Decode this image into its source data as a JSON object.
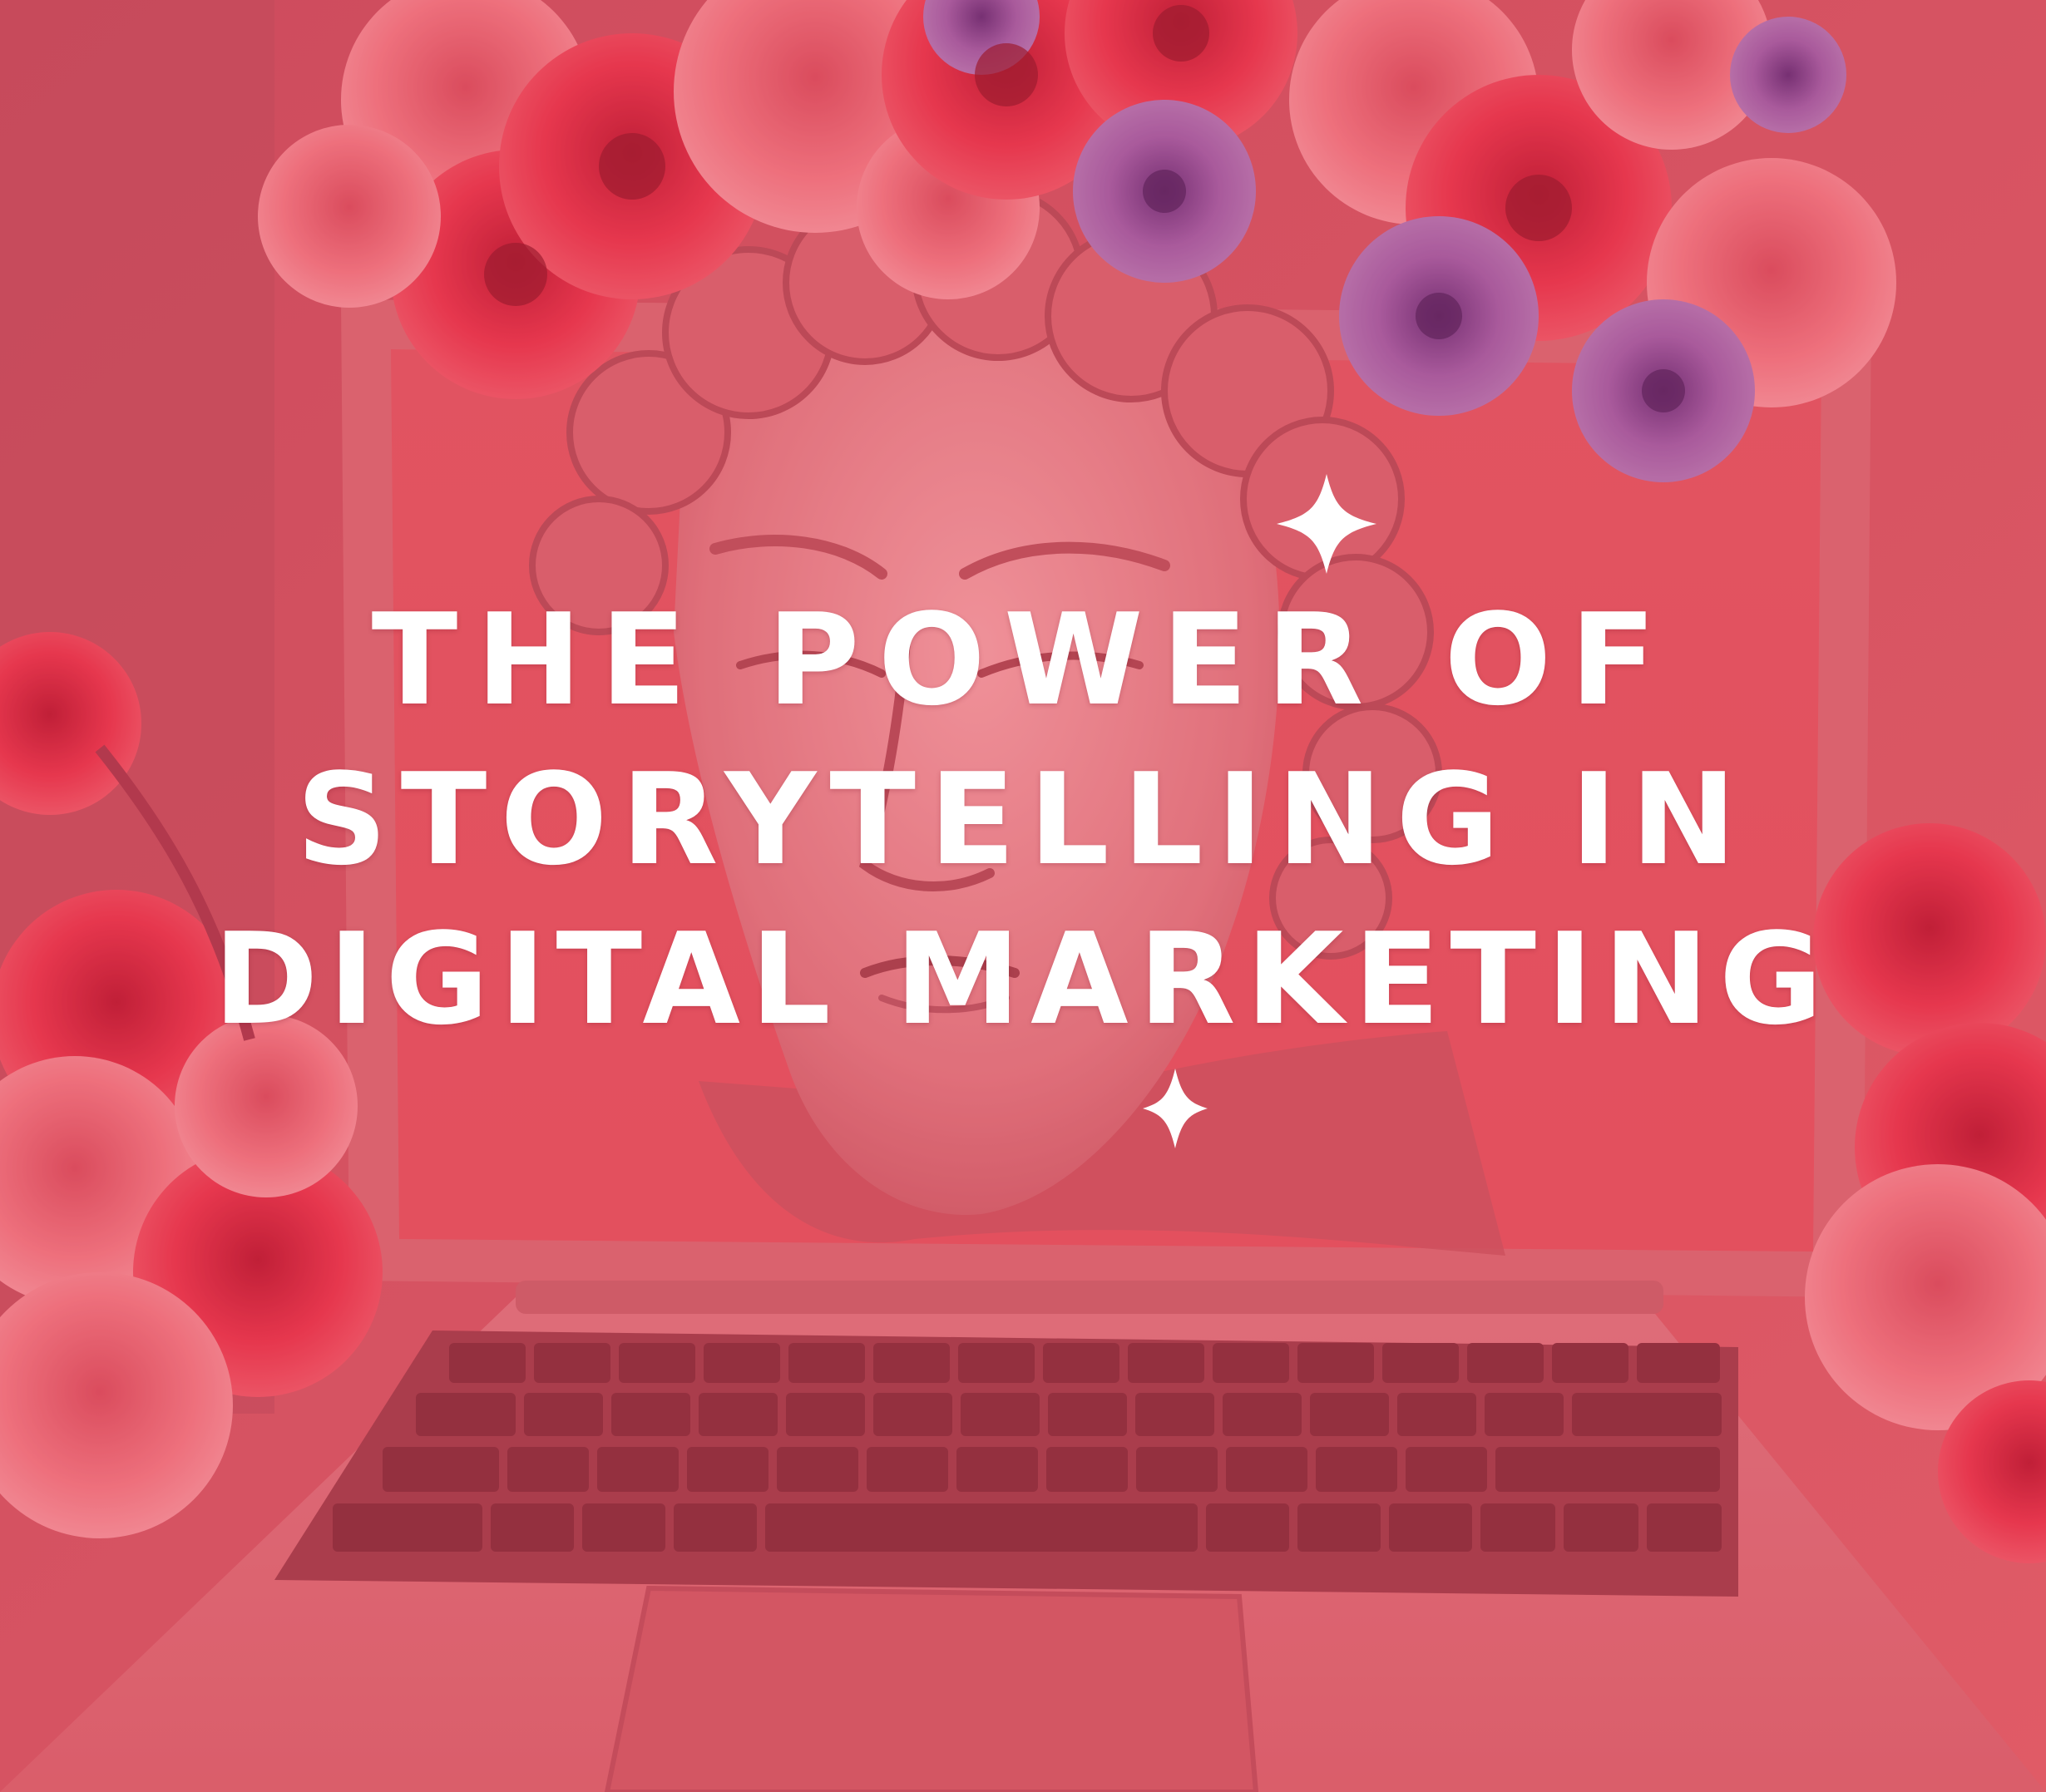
{
  "headline": {
    "line_1": "THE POWER OF",
    "line_2": "STORYTELLING IN",
    "line_3": "DIGITAL MARKETING"
  },
  "colors": {
    "overlay_tint": "#e04b5c",
    "background": "#d8505d",
    "text": "#ffffff",
    "rose_red": "#e8324a",
    "rose_pink": "#f27b86",
    "flower_purple": "#9a5fae"
  },
  "icons": [
    "sparkle-icon",
    "sparkle-icon"
  ]
}
